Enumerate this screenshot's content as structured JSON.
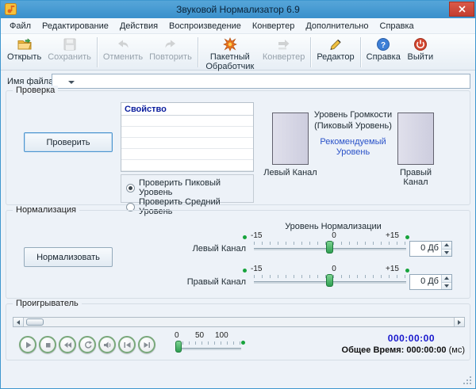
{
  "window": {
    "title": "Звуковой Нормализатор 6.9"
  },
  "menu": {
    "items": [
      {
        "label": "Файл"
      },
      {
        "label": "Редактирование"
      },
      {
        "label": "Действия"
      },
      {
        "label": "Воспроизведение"
      },
      {
        "label": "Конвертер"
      },
      {
        "label": "Дополнительно"
      },
      {
        "label": "Справка"
      }
    ]
  },
  "toolbar": {
    "items": [
      {
        "label": "Открыть",
        "enabled": true,
        "icon": "open-folder-icon"
      },
      {
        "label": "Сохранить",
        "enabled": false,
        "icon": "save-floppy-icon"
      },
      {
        "label": "Отменить",
        "enabled": false,
        "icon": "undo-icon"
      },
      {
        "label": "Повторить",
        "enabled": false,
        "icon": "redo-icon"
      },
      {
        "label": "Пакетный Обработчик",
        "enabled": true,
        "icon": "batch-processor-icon"
      },
      {
        "label": "Конвертер",
        "enabled": false,
        "icon": "converter-icon"
      },
      {
        "label": "Редактор",
        "enabled": true,
        "icon": "editor-pencil-icon"
      },
      {
        "label": "Справка",
        "enabled": true,
        "icon": "help-icon"
      },
      {
        "label": "Выйти",
        "enabled": true,
        "icon": "exit-icon"
      }
    ]
  },
  "file_row": {
    "label": "Имя файла:",
    "value": ""
  },
  "check": {
    "group_title": "Проверка",
    "check_button": "Проверить",
    "table": {
      "header": "Свойство",
      "rows": [
        "",
        "",
        "",
        "",
        ""
      ]
    },
    "volume_title_line1": "Уровень Громкости",
    "volume_title_line2": "(Пиковый Уровень)",
    "recommended_line1": "Рекомендуемый",
    "recommended_line2": "Уровень",
    "left_channel_label": "Левый Канал",
    "right_channel_label": "Правый Канал",
    "radio_peak": "Проверить Пиковый Уровень",
    "radio_average": "Проверить Средний Уровень",
    "radio_selected": "peak"
  },
  "normalization": {
    "group_title": "Нормализация",
    "normalize_button": "Нормализовать",
    "level_title": "Уровень Нормализации",
    "scale": {
      "min": "-15",
      "mid": "0",
      "max": "+15"
    },
    "left": {
      "label": "Левый Канал",
      "value": "0 Дб"
    },
    "right": {
      "label": "Правый Канал",
      "value": "0 Дб"
    }
  },
  "player": {
    "group_title": "Проигрыватель",
    "buttons": [
      {
        "name": "play"
      },
      {
        "name": "stop"
      },
      {
        "name": "rewind"
      },
      {
        "name": "repeat"
      },
      {
        "name": "volume"
      },
      {
        "name": "previous"
      },
      {
        "name": "next"
      }
    ],
    "volume_scale": [
      "0",
      "50",
      "100"
    ],
    "current_time": "000:00:00",
    "total_time_label": "Общее Время:",
    "total_time_value": "000:00:00",
    "total_time_unit": "(мс)"
  }
}
